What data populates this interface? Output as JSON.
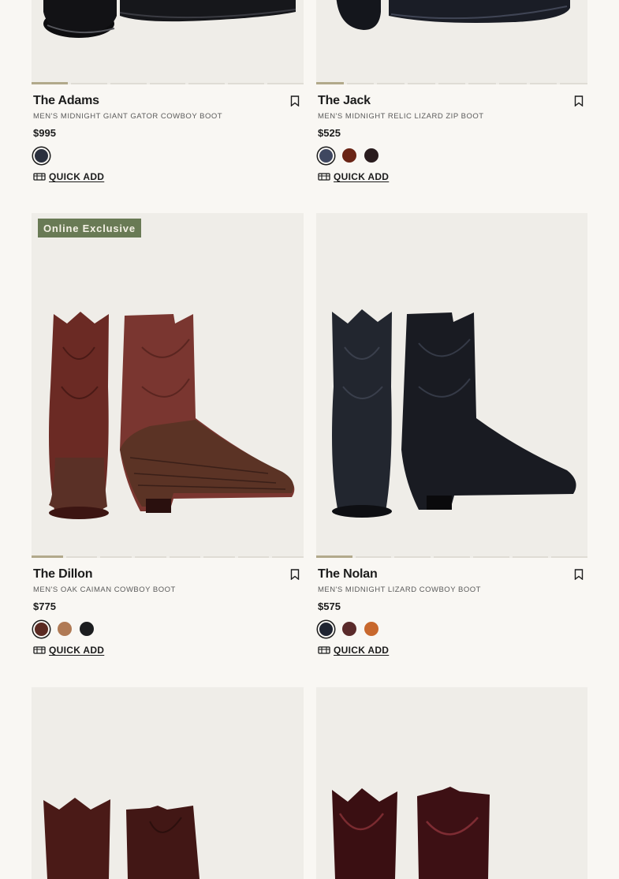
{
  "products": [
    {
      "title": "The Adams",
      "subtitle": "Men's Midnight Giant Gator Cowboy Boot",
      "price": "$995",
      "badge": "",
      "swatch_colors": [
        "#2a2f3d"
      ],
      "image_count": 7,
      "quick_add": "QUICK ADD"
    },
    {
      "title": "The Jack",
      "subtitle": "Men's Midnight Relic Lizard Zip Boot",
      "price": "$525",
      "badge": "",
      "swatch_colors": [
        "#3f4760",
        "#6a2415",
        "#2a1c1e"
      ],
      "image_count": 9,
      "quick_add": "QUICK ADD"
    },
    {
      "title": "The Dillon",
      "subtitle": "Men's Oak Caiman Cowboy Boot",
      "price": "$775",
      "badge": "Online Exclusive",
      "swatch_colors": [
        "#5b2a22",
        "#b07a55",
        "#1c1d1f"
      ],
      "image_count": 8,
      "quick_add": "QUICK ADD"
    },
    {
      "title": "The Nolan",
      "subtitle": "Men's Midnight Lizard Cowboy Boot",
      "price": "$575",
      "badge": "",
      "swatch_colors": [
        "#1f2431",
        "#5a2a2a",
        "#c8682d"
      ],
      "image_count": 7,
      "quick_add": "QUICK ADD"
    }
  ],
  "colors": {
    "background": "#f9f7f3",
    "image_bg": "#efede8",
    "badge_bg": "#697a55",
    "progress_active": "#b2a98b"
  },
  "icons": {
    "bookmark": "bookmark-icon",
    "quick_add": "cart-icon"
  }
}
